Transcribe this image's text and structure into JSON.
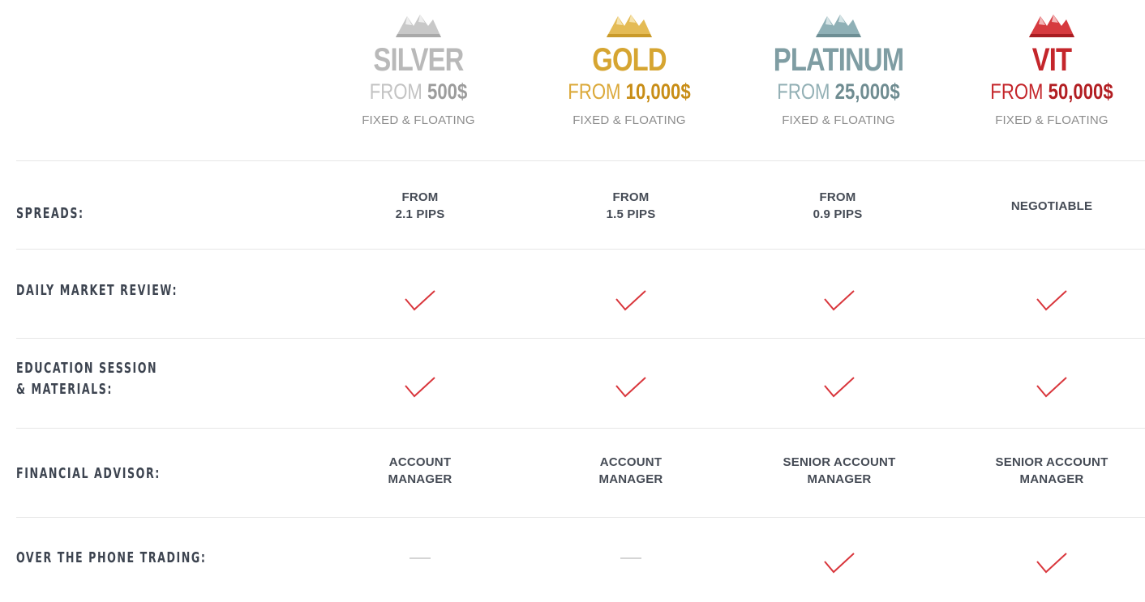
{
  "colors": {
    "silver": "#b9b9b9",
    "silver_amount": "#9c9c9c",
    "gold": "#d6a531",
    "gold_amount": "#c88d16",
    "platinum": "#7f9da3",
    "platinum_amount": "#6f8c91",
    "vit": "#c4262b",
    "vit_amount": "#b21e22",
    "check": "#d9363c",
    "label": "#3d4450"
  },
  "plans": [
    {
      "name": "SILVER",
      "from": "FROM",
      "amount": "500$",
      "type": "FIXED & FLOATING",
      "logo_icon": "mountain-logo-icon"
    },
    {
      "name": "GOLD",
      "from": "FROM",
      "amount": "10,000$",
      "type": "FIXED & FLOATING",
      "logo_icon": "mountain-logo-icon"
    },
    {
      "name": "PLATINUM",
      "from": "FROM",
      "amount": "25,000$",
      "type": "FIXED & FLOATING",
      "logo_icon": "mountain-logo-icon"
    },
    {
      "name": "VIT",
      "from": "FROM",
      "amount": "50,000$",
      "type": "FIXED & FLOATING",
      "logo_icon": "mountain-logo-icon"
    }
  ],
  "features": {
    "spreads": {
      "label": "SPREADS:",
      "values": [
        {
          "line1": "FROM",
          "line2": "2.1 PIPS"
        },
        {
          "line1": "FROM",
          "line2": "1.5 PIPS"
        },
        {
          "line1": "FROM",
          "line2": "0.9 PIPS"
        },
        {
          "line1": "NEGOTIABLE",
          "line2": ""
        }
      ]
    },
    "daily_review": {
      "label": "DAILY MARKET REVIEW:",
      "values": [
        "check-icon",
        "check-icon",
        "check-icon",
        "check-icon"
      ]
    },
    "education": {
      "label_line1": "EDUCATION SESSION",
      "label_line2": "& MATERIALS:",
      "values": [
        "check-icon",
        "check-icon",
        "check-icon",
        "check-icon"
      ]
    },
    "advisor": {
      "label": "FINANCIAL ADVISOR:",
      "values": [
        {
          "line1": "ACCOUNT",
          "line2": "MANAGER"
        },
        {
          "line1": "ACCOUNT",
          "line2": "MANAGER"
        },
        {
          "line1": "SENIOR ACCOUNT",
          "line2": "MANAGER"
        },
        {
          "line1": "SENIOR ACCOUNT",
          "line2": "MANAGER"
        }
      ]
    },
    "phone_trading": {
      "label": "OVER THE PHONE TRADING:",
      "values": [
        "dash-icon",
        "dash-icon",
        "check-icon",
        "check-icon"
      ]
    }
  }
}
